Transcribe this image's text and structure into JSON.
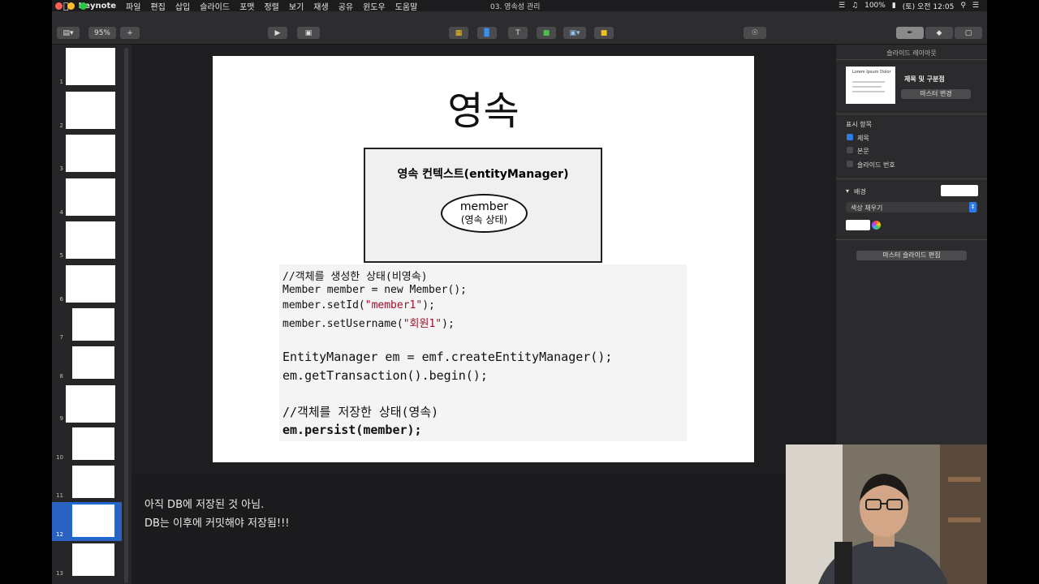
{
  "menubar": {
    "app_name": "Keynote",
    "items": [
      "파일",
      "편집",
      "삽입",
      "슬라이드",
      "포맷",
      "정렬",
      "보기",
      "재생",
      "공유",
      "윈도우",
      "도움말"
    ],
    "document_title": "03. 영속성 관리",
    "battery": "100%",
    "clock": "(토) 오전 12:05"
  },
  "toolbar": {
    "zoom": "95%"
  },
  "navigator": {
    "slide_numbers": [
      "1",
      "2",
      "3",
      "4",
      "5",
      "6",
      "7",
      "8",
      "9",
      "10",
      "11",
      "12",
      "13"
    ],
    "selected": "12"
  },
  "slide": {
    "title": "영속",
    "context_box_title": "영속 컨텍스트(entityManager)",
    "entity_name": "member",
    "entity_state": "(영속 상태)",
    "code_lines": [
      "//객체를 생성한 상태(비영속)",
      "Member member = new Member();",
      "member.setId(\"member1\");",
      "member.setUsername(\"회원1\");",
      "EntityManager em = emf.createEntityManager();",
      "em.getTransaction().begin();",
      "//객체를 저장한 상태(영속)",
      "em.persist(member);"
    ]
  },
  "notes": {
    "line1": "아직 DB에 저장된 것 아님.",
    "line2": "DB는 이후에 커밋해야 저장됨!!!"
  },
  "inspector": {
    "header": "슬라이드 레이아웃",
    "layout_name": "제목 및 구분점",
    "master_change_button": "마스터 변경",
    "appearance_label": "표시 항목",
    "opt_title": "제목",
    "opt_body": "본문",
    "opt_slide_number": "슬라이드 번호",
    "background_label": "배경",
    "fill_select": "색상 채우기",
    "edit_master_button": "마스터 슬라이드 편집",
    "thumb_text": "Lorem Ipsum Dolor"
  },
  "colors": {
    "accent": "#2a63c4",
    "string_literal": "#a0102a"
  }
}
